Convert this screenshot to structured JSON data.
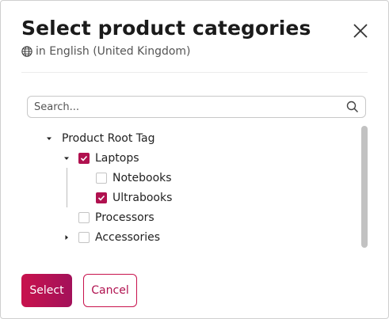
{
  "dialog": {
    "title": "Select product categories",
    "locale_label": "in English (United Kingdom)",
    "locale_icon": "globe-icon",
    "close_icon": "close-icon"
  },
  "search": {
    "placeholder": "Search...",
    "value": "",
    "icon": "search-icon"
  },
  "tree": {
    "nodes": [
      {
        "label": "Product Root Tag",
        "expanded": true,
        "checked": null
      },
      {
        "label": "Laptops",
        "expanded": true,
        "checked": true
      },
      {
        "label": "Notebooks",
        "checked": false
      },
      {
        "label": "Ultrabooks",
        "checked": true
      },
      {
        "label": "Processors",
        "checked": false
      },
      {
        "label": "Accessories",
        "expanded": false,
        "checked": false
      }
    ]
  },
  "actions": {
    "select_label": "Select",
    "cancel_label": "Cancel"
  },
  "colors": {
    "accent": "#b0114f",
    "accent_start": "#c8124d"
  }
}
